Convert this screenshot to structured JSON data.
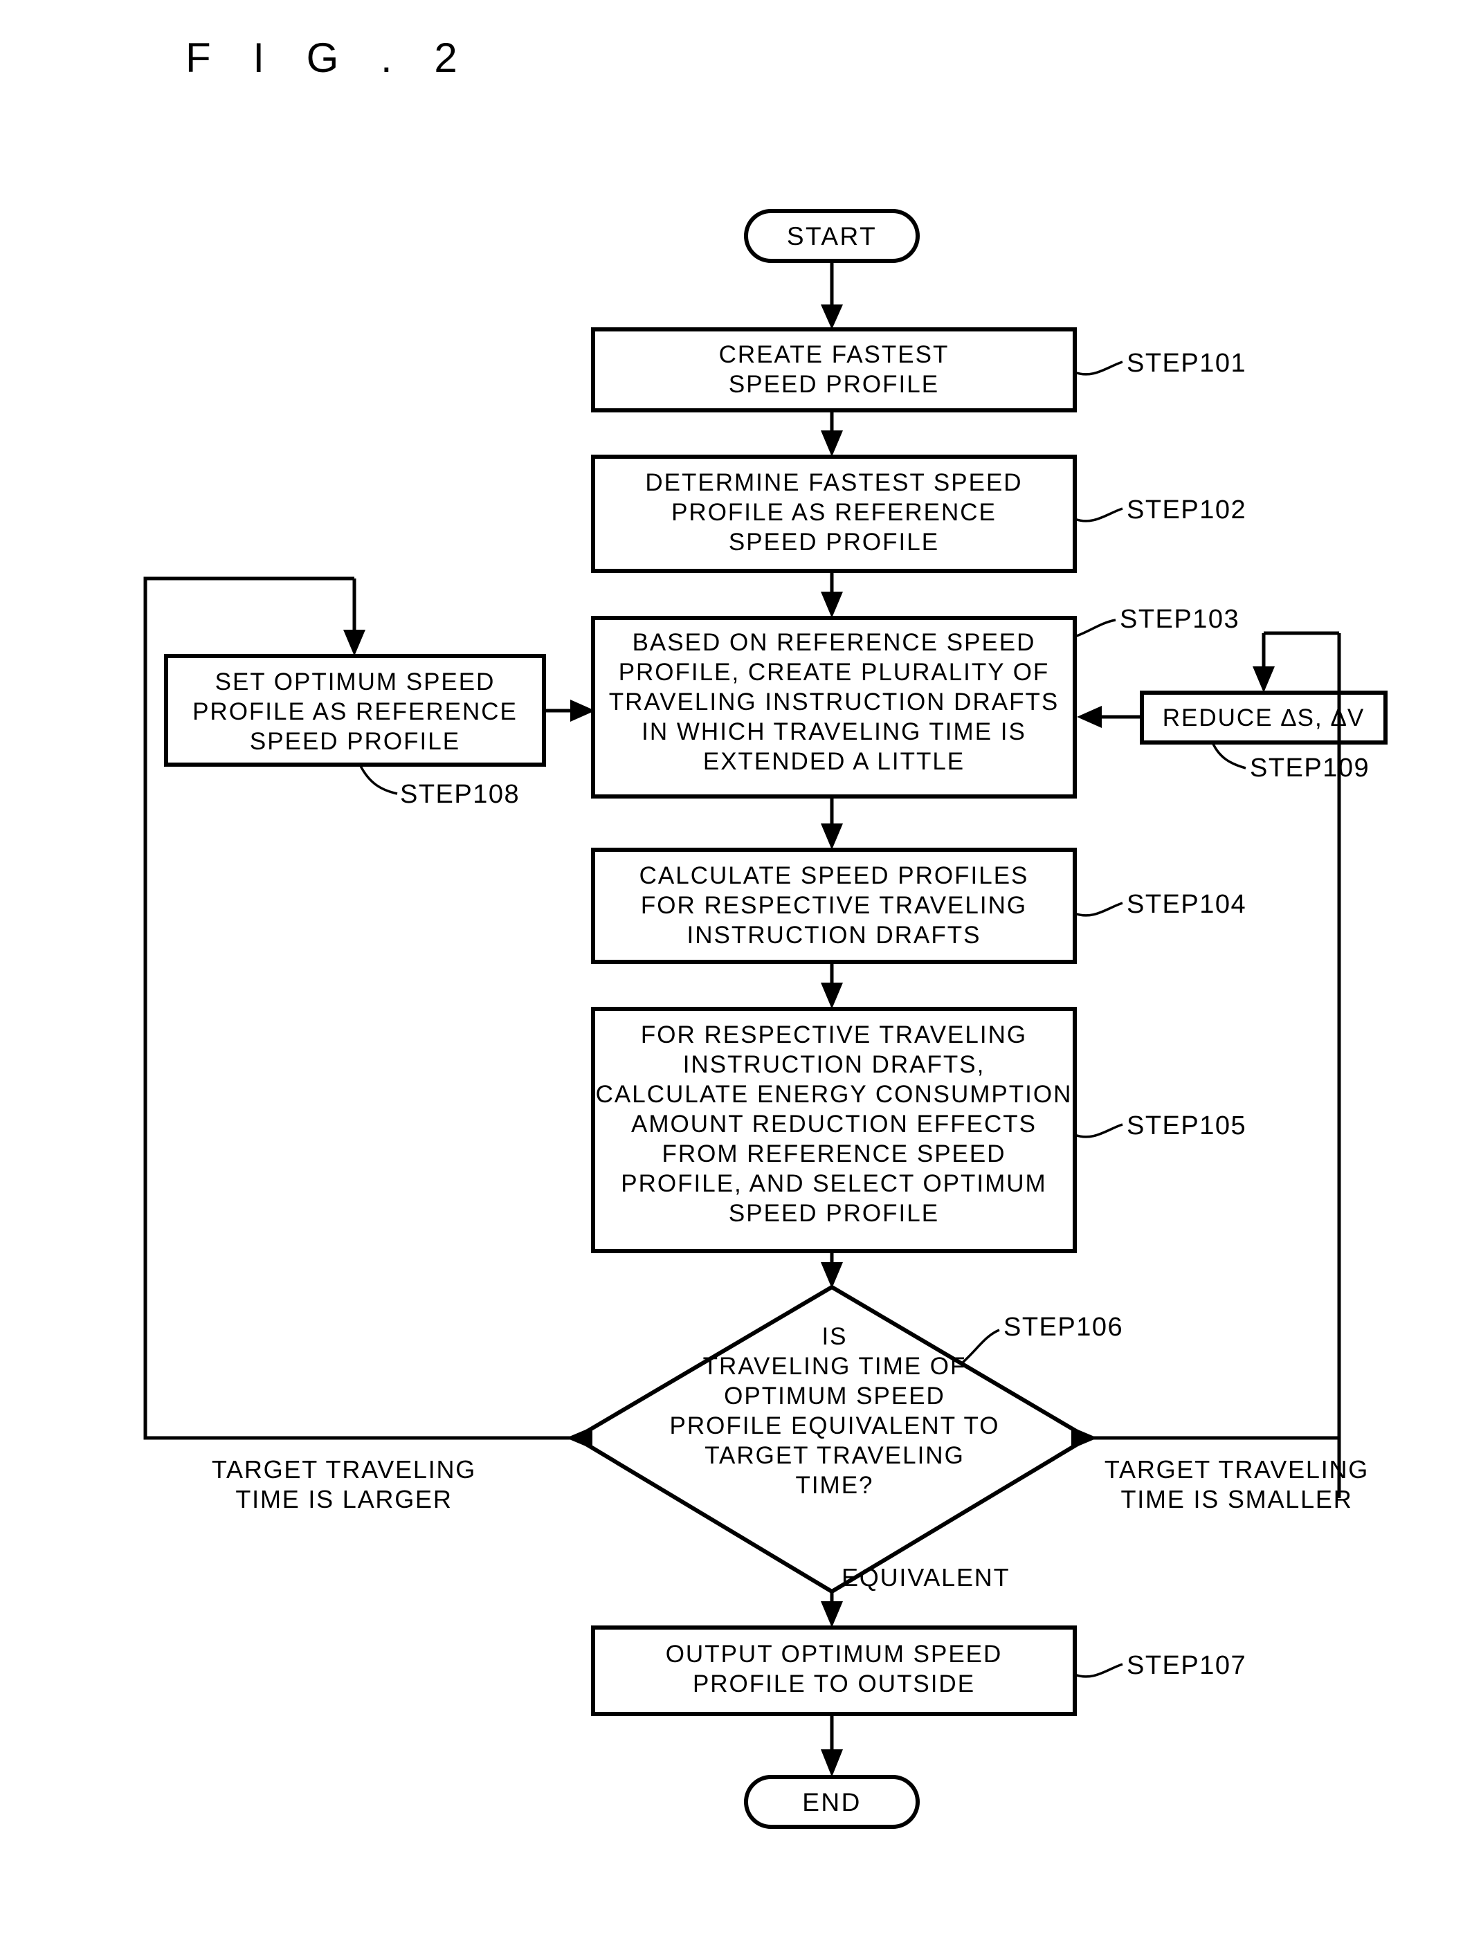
{
  "figure": {
    "title": "F I G .  2",
    "title_plain": "FIG. 2"
  },
  "terminators": {
    "start": "START",
    "end": "END"
  },
  "nodes": {
    "step101": {
      "id": "STEP101",
      "lines": [
        "CREATE FASTEST",
        "SPEED PROFILE"
      ]
    },
    "step102": {
      "id": "STEP102",
      "lines": [
        "DETERMINE FASTEST SPEED",
        "PROFILE AS REFERENCE",
        "SPEED PROFILE"
      ]
    },
    "step103": {
      "id": "STEP103",
      "lines": [
        "BASED ON REFERENCE SPEED",
        "PROFILE, CREATE PLURALITY OF",
        "TRAVELING INSTRUCTION DRAFTS",
        "IN WHICH TRAVELING TIME IS",
        "EXTENDED A LITTLE"
      ]
    },
    "step104": {
      "id": "STEP104",
      "lines": [
        "CALCULATE SPEED PROFILES",
        "FOR RESPECTIVE TRAVELING",
        "INSTRUCTION DRAFTS"
      ]
    },
    "step105": {
      "id": "STEP105",
      "lines": [
        "FOR RESPECTIVE TRAVELING",
        "INSTRUCTION DRAFTS,",
        "CALCULATE ENERGY CONSUMPTION",
        "AMOUNT REDUCTION EFFECTS",
        "FROM REFERENCE SPEED",
        "PROFILE, AND SELECT OPTIMUM",
        "SPEED PROFILE"
      ]
    },
    "step106": {
      "id": "STEP106",
      "lines": [
        "IS",
        "TRAVELING TIME OF",
        "OPTIMUM SPEED",
        "PROFILE EQUIVALENT TO",
        "TARGET TRAVELING",
        "TIME?"
      ]
    },
    "step107": {
      "id": "STEP107",
      "lines": [
        "OUTPUT OPTIMUM SPEED",
        "PROFILE TO OUTSIDE"
      ]
    },
    "step108": {
      "id": "STEP108",
      "lines": [
        "SET OPTIMUM SPEED",
        "PROFILE AS REFERENCE",
        "SPEED PROFILE"
      ]
    },
    "step109": {
      "id": "STEP109",
      "lines": [
        "REDUCE ∆S, ∆V"
      ]
    }
  },
  "edge_labels": {
    "larger": [
      "TARGET TRAVELING",
      "TIME IS LARGER"
    ],
    "smaller": [
      "TARGET TRAVELING",
      "TIME IS SMALLER"
    ],
    "equivalent": "EQUIVALENT"
  },
  "colors": {
    "ink": "#000000",
    "paper": "#ffffff"
  }
}
